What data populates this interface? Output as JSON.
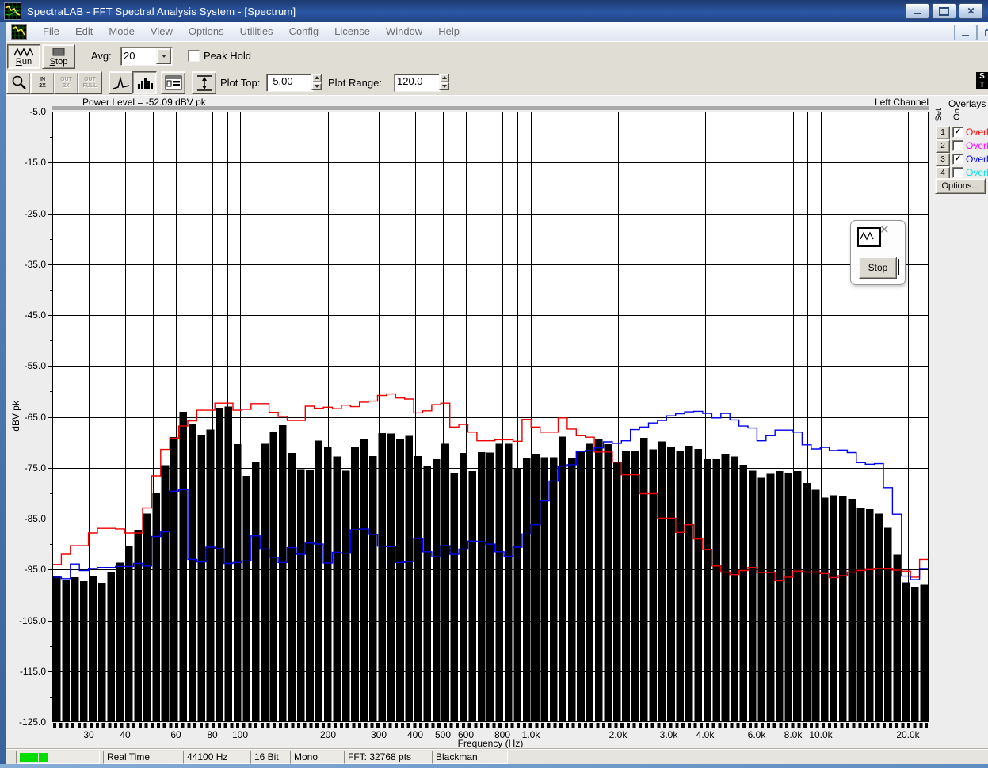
{
  "window": {
    "title": "SpectraLAB - FFT Spectral Analysis System - [Spectrum]"
  },
  "menu": {
    "items": [
      "File",
      "Edit",
      "Mode",
      "View",
      "Options",
      "Utilities",
      "Config",
      "License",
      "Window",
      "Help"
    ]
  },
  "toolbar_main": {
    "run_label": "Run",
    "stop_label": "Stop",
    "avg_label": "Avg:",
    "avg_value": "20",
    "peak_hold_label": "Peak Hold",
    "peak_hold_checked": false
  },
  "toolbar_plot": {
    "zoom_in_line1": "IN",
    "zoom_in_line2": "2X",
    "zoom_out_line1": "OUT",
    "zoom_out_line2": "2X",
    "zoom_full_line1": "OUT",
    "zoom_full_line2": "FULL",
    "plot_top_label": "Plot Top:",
    "plot_top_value": "-5.00",
    "plot_range_label": "Plot Range:",
    "plot_range_value": "120.0"
  },
  "logo": {
    "line1": "S",
    "line2": "T"
  },
  "chart": {
    "header_left": "Power Level = -52.09 dBV pk",
    "header_right": "Left Channel"
  },
  "chart_data": {
    "type": "bar",
    "xlabel": "Frequency (Hz)",
    "ylabel": "dBV pk",
    "x_scale": "log",
    "xlim": [
      22.5,
      23500
    ],
    "ylim": [
      -125,
      -5
    ],
    "grid": true,
    "y_tick_labels": [
      "-5.0",
      "-15.0",
      "-25.0",
      "-35.0",
      "-45.0",
      "-55.0",
      "-65.0",
      "-75.0",
      "-85.0",
      "-95.0",
      "-105.0",
      "-115.0",
      "-125.0"
    ],
    "x_ticks": [
      {
        "f": 30,
        "label": "30"
      },
      {
        "f": 40,
        "label": "40"
      },
      {
        "f": 60,
        "label": "60"
      },
      {
        "f": 80,
        "label": "80"
      },
      {
        "f": 100,
        "label": "100"
      },
      {
        "f": 200,
        "label": "200"
      },
      {
        "f": 300,
        "label": "300"
      },
      {
        "f": 400,
        "label": "400"
      },
      {
        "f": 500,
        "label": "500"
      },
      {
        "f": 600,
        "label": "600"
      },
      {
        "f": 800,
        "label": "800"
      },
      {
        "f": 1000,
        "label": "1.0k"
      },
      {
        "f": 2000,
        "label": "2.0k"
      },
      {
        "f": 3000,
        "label": "3.0k"
      },
      {
        "f": 4000,
        "label": "4.0k"
      },
      {
        "f": 6000,
        "label": "6.0k"
      },
      {
        "f": 8000,
        "label": "8.0k"
      },
      {
        "f": 10000,
        "label": "10.0k"
      },
      {
        "f": 20000,
        "label": "20.0k"
      }
    ],
    "grid_frequencies": [
      30,
      40,
      50,
      60,
      70,
      80,
      90,
      100,
      200,
      300,
      400,
      500,
      600,
      700,
      800,
      900,
      1000,
      2000,
      3000,
      4000,
      5000,
      6000,
      7000,
      8000,
      9000,
      10000,
      20000
    ],
    "bars": {
      "color": "#000000",
      "frequencies_hz": [
        22,
        23.6,
        25.4,
        27.3,
        29.3,
        31.5,
        33.8,
        36.3,
        39,
        41.9,
        45,
        48.4,
        52,
        55.8,
        60,
        64.4,
        69.2,
        74.3,
        79.9,
        85.8,
        92.2,
        99,
        106,
        114,
        123,
        132,
        142,
        152,
        164,
        176,
        189,
        203,
        218,
        234,
        251,
        270,
        290,
        311,
        335,
        359,
        386,
        415,
        445,
        478,
        514,
        552,
        593,
        637,
        684,
        735,
        790,
        848,
        911,
        979,
        1051,
        1129,
        1213,
        1303,
        1400,
        1504,
        1615,
        1735,
        1864,
        2002,
        2151,
        2310,
        2482,
        2666,
        2864,
        3076,
        3304,
        3549,
        3813,
        4096,
        4400,
        4726,
        5077,
        5454,
        5858,
        6293,
        6760,
        7261,
        7800,
        8379,
        9000,
        9668,
        10385,
        11156,
        11983,
        12872,
        13827,
        14853,
        15955,
        17138,
        18410,
        19776,
        21243
      ],
      "levels_dbv": [
        -96.2,
        -97,
        -96.5,
        -97.3,
        -96.4,
        -97.6,
        -95.4,
        -93.6,
        -90.4,
        -87.2,
        -84,
        -80,
        -74.5,
        -69,
        -64,
        -66.5,
        -68.5,
        -67.5,
        -63.2,
        -63,
        -70.4,
        -76.6,
        -73.8,
        -70.3,
        -67.9,
        -66.6,
        -72.1,
        -75.3,
        -75.4,
        -69.7,
        -71,
        -72.8,
        -75.6,
        -71,
        -69.4,
        -72.7,
        -68.2,
        -68.3,
        -69.3,
        -68.7,
        -72.7,
        -74.7,
        -73.3,
        -70.3,
        -76,
        -72.1,
        -75.7,
        -71.9,
        -72,
        -70.3,
        -70.3,
        -75.1,
        -73.2,
        -72.4,
        -72.9,
        -72.9,
        -68.9,
        -73,
        -71.6,
        -70.3,
        -69.4,
        -70.4,
        -73.9,
        -71.8,
        -71.6,
        -69.1,
        -71.4,
        -69.8,
        -70.8,
        -71.6,
        -70.7,
        -71.3,
        -73.3,
        -73.3,
        -72.2,
        -72.8,
        -74.4,
        -75.6,
        -77,
        -76.2,
        -75.7,
        -76,
        -75.7,
        -78,
        -79.3,
        -80.9,
        -80.4,
        -80.6,
        -81.1,
        -83,
        -83.1,
        -84,
        -86.8,
        -92.1,
        -97.5,
        -98.5,
        -98
      ]
    },
    "overlays": [
      {
        "name": "overlay-1-red",
        "color": "#ee0000",
        "levels_dbv": [
          -94,
          -92,
          -90.3,
          -90.3,
          -87.8,
          -86.9,
          -86.9,
          -87,
          -87.8,
          -87.8,
          -82.9,
          -76.6,
          -71.4,
          -69.2,
          -66.8,
          -65.8,
          -63.7,
          -63.7,
          -62.3,
          -62.3,
          -63.7,
          -63.5,
          -62.4,
          -62.4,
          -64.1,
          -64.9,
          -65.7,
          -65.7,
          -62.9,
          -63.3,
          -63.1,
          -63.4,
          -62.7,
          -63,
          -62.1,
          -61.9,
          -60.8,
          -60.5,
          -61.3,
          -61.5,
          -64.2,
          -63.8,
          -62.6,
          -62.3,
          -67,
          -66.5,
          -68,
          -69.7,
          -69.7,
          -69.5,
          -69.5,
          -69.8,
          -65.5,
          -67,
          -68,
          -68,
          -65.2,
          -67.4,
          -68.7,
          -69,
          -71.9,
          -71.9,
          -73.9,
          -76.4,
          -76.4,
          -80.1,
          -80.1,
          -84.9,
          -84.9,
          -87.7,
          -86.2,
          -89,
          -91.1,
          -94.3,
          -95.5,
          -96,
          -95.2,
          -94.6,
          -95.6,
          -95.6,
          -97.2,
          -96.5,
          -95.3,
          -95.5,
          -95.5,
          -95.8,
          -96.6,
          -96.2,
          -95.5,
          -95.2,
          -95,
          -94.8,
          -94.9,
          -95.1,
          -95.3,
          -96.5,
          -93
        ]
      },
      {
        "name": "overlay-3-blue",
        "color": "#0000ee",
        "levels_dbv": [
          -96.5,
          -96.8,
          -93.9,
          -95.2,
          -94.8,
          -94.6,
          -94.6,
          -94.4,
          -94.4,
          -93.8,
          -94.3,
          -88.5,
          -87.6,
          -79.6,
          -79.3,
          -93,
          -93.5,
          -90.6,
          -90.9,
          -93.8,
          -93.6,
          -93.3,
          -88.4,
          -91,
          -92.6,
          -93.6,
          -90.7,
          -92,
          -89.8,
          -90,
          -93.7,
          -91.6,
          -91.8,
          -87.2,
          -87,
          -88.1,
          -90.4,
          -90.5,
          -93.6,
          -93.4,
          -88.9,
          -91.5,
          -92.5,
          -90.3,
          -92,
          -91,
          -89.4,
          -89.5,
          -90,
          -91.5,
          -92.4,
          -90.6,
          -88,
          -86.2,
          -81.5,
          -77.6,
          -74.7,
          -74.4,
          -71.8,
          -71.6,
          -71.1,
          -69.9,
          -70.2,
          -69.7,
          -67.5,
          -67,
          -66.2,
          -65.7,
          -64.8,
          -64.4,
          -64,
          -63.9,
          -64.3,
          -65.2,
          -64.3,
          -65.6,
          -66.8,
          -67.2,
          -69.7,
          -68.7,
          -67.6,
          -67.6,
          -68,
          -70.5,
          -71.3,
          -71,
          -71.6,
          -71.5,
          -72,
          -74,
          -74.3,
          -74.2,
          -78.9,
          -84.1,
          -96.3,
          -97,
          -94.8
        ]
      }
    ]
  },
  "overlays_panel": {
    "title": "Overlays",
    "col_set": "Set",
    "col_on": "On",
    "rows": [
      {
        "num": "1",
        "checked": true,
        "label": "Overla",
        "color": "#ff0000"
      },
      {
        "num": "2",
        "checked": false,
        "label": "Overla",
        "color": "#ff00ff"
      },
      {
        "num": "3",
        "checked": true,
        "label": "Overla",
        "color": "#0000ff"
      },
      {
        "num": "4",
        "checked": false,
        "label": "Overla",
        "color": "#00e5e5"
      }
    ],
    "options_label": "Options..."
  },
  "float_panel": {
    "stop_label": "Stop"
  },
  "status_bar": {
    "segments": [
      "Real Time",
      "44100 Hz",
      "16 Bit",
      "Mono",
      "FFT: 32768 pts",
      "Blackman"
    ],
    "led_color": "#00dd00",
    "led_count": 3
  }
}
